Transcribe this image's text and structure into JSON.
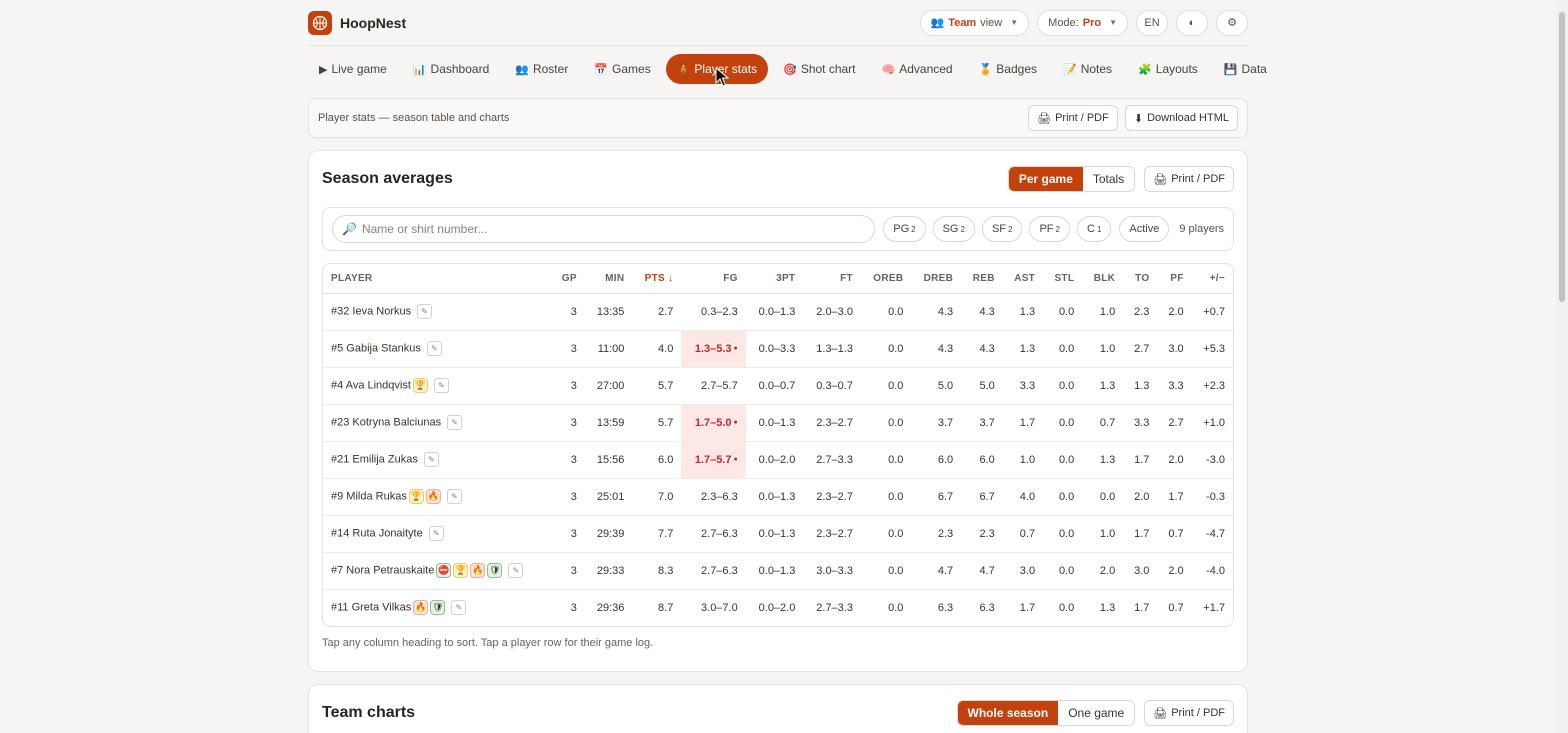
{
  "app": {
    "name": "HoopNest",
    "brand_color": "#c2410c"
  },
  "top": {
    "view_label": "Team",
    "view_suffix": "view",
    "mode_label": "Mode:",
    "mode_value": "Pro",
    "lang": "EN"
  },
  "nav": [
    {
      "icon": "▶",
      "label": "Live game"
    },
    {
      "icon": "📊",
      "label": "Dashboard"
    },
    {
      "icon": "👥",
      "label": "Roster"
    },
    {
      "icon": "📅",
      "label": "Games"
    },
    {
      "icon": "🧍",
      "label": "Player stats",
      "active": true
    },
    {
      "icon": "🎯",
      "label": "Shot chart"
    },
    {
      "icon": "🧠",
      "label": "Advanced"
    },
    {
      "icon": "🏅",
      "label": "Badges"
    },
    {
      "icon": "📝",
      "label": "Notes"
    },
    {
      "icon": "🧩",
      "label": "Layouts"
    },
    {
      "icon": "💾",
      "label": "Data"
    }
  ],
  "subbar": {
    "crumb": "Player stats — season table and charts",
    "print": "Print / PDF",
    "download": "Download HTML"
  },
  "season": {
    "title": "Season averages",
    "seg_per_game": "Per game",
    "seg_totals": "Totals",
    "print": "Print / PDF",
    "search_placeholder": "Name or shirt number...",
    "chips": [
      {
        "label": "PG",
        "count": "2"
      },
      {
        "label": "SG",
        "count": "2"
      },
      {
        "label": "SF",
        "count": "2"
      },
      {
        "label": "PF",
        "count": "2"
      },
      {
        "label": "C",
        "count": "1"
      }
    ],
    "active_chip": "Active",
    "player_count": "9 players",
    "columns": [
      "PLAYER",
      "GP",
      "MIN",
      "PTS ↓",
      "FG",
      "3PT",
      "FT",
      "OREB",
      "DREB",
      "REB",
      "AST",
      "STL",
      "BLK",
      "TO",
      "PF",
      "+/−"
    ],
    "rows": [
      {
        "player": "#32 Ieva Norkus",
        "badges": [],
        "gp": "3",
        "min": "13:35",
        "pts": "2.7",
        "fg": "0.3–2.3",
        "fg_hot": false,
        "tpt": "0.0–1.3",
        "ft": "2.0–3.0",
        "oreb": "0.0",
        "dreb": "4.3",
        "reb": "4.3",
        "ast": "1.3",
        "stl": "0.0",
        "blk": "1.0",
        "to": "2.3",
        "pf": "2.0",
        "pm": "+0.7"
      },
      {
        "player": "#5 Gabija Stankus",
        "badges": [],
        "gp": "3",
        "min": "11:00",
        "pts": "4.0",
        "fg": "1.3–5.3",
        "fg_hot": true,
        "tpt": "0.0–3.3",
        "ft": "1.3–1.3",
        "oreb": "0.0",
        "dreb": "4.3",
        "reb": "4.3",
        "ast": "1.3",
        "stl": "0.0",
        "blk": "1.0",
        "to": "2.7",
        "pf": "3.0",
        "pm": "+5.3"
      },
      {
        "player": "#4 Ava Lindqvist",
        "badges": [
          "trophy"
        ],
        "gp": "3",
        "min": "27:00",
        "pts": "5.7",
        "fg": "2.7–5.7",
        "fg_hot": false,
        "tpt": "0.0–0.7",
        "ft": "0.3–0.7",
        "oreb": "0.0",
        "dreb": "5.0",
        "reb": "5.0",
        "ast": "3.3",
        "stl": "0.0",
        "blk": "1.3",
        "to": "1.3",
        "pf": "3.3",
        "pm": "+2.3"
      },
      {
        "player": "#23 Kotryna Balciunas",
        "badges": [],
        "gp": "3",
        "min": "13:59",
        "pts": "5.7",
        "fg": "1.7–5.0",
        "fg_hot": true,
        "tpt": "0.0–1.3",
        "ft": "2.3–2.7",
        "oreb": "0.0",
        "dreb": "3.7",
        "reb": "3.7",
        "ast": "1.7",
        "stl": "0.0",
        "blk": "0.7",
        "to": "3.3",
        "pf": "2.7",
        "pm": "+1.0"
      },
      {
        "player": "#21 Emilija Zukas",
        "badges": [],
        "gp": "3",
        "min": "15:56",
        "pts": "6.0",
        "fg": "1.7–5.7",
        "fg_hot": true,
        "tpt": "0.0–2.0",
        "ft": "2.7–3.3",
        "oreb": "0.0",
        "dreb": "6.0",
        "reb": "6.0",
        "ast": "1.0",
        "stl": "0.0",
        "blk": "1.3",
        "to": "1.7",
        "pf": "2.0",
        "pm": "-3.0"
      },
      {
        "player": "#9 Milda Rukas",
        "badges": [
          "trophy",
          "fire"
        ],
        "gp": "3",
        "min": "25:01",
        "pts": "7.0",
        "fg": "2.3–6.3",
        "fg_hot": false,
        "tpt": "0.0–1.3",
        "ft": "2.3–2.7",
        "oreb": "0.0",
        "dreb": "6.7",
        "reb": "6.7",
        "ast": "4.0",
        "stl": "0.0",
        "blk": "0.0",
        "to": "2.0",
        "pf": "1.7",
        "pm": "-0.3"
      },
      {
        "player": "#14 Ruta Jonaityte",
        "badges": [],
        "gp": "3",
        "min": "29:39",
        "pts": "7.7",
        "fg": "2.7–6.3",
        "fg_hot": false,
        "tpt": "0.0–1.3",
        "ft": "2.3–2.7",
        "oreb": "0.0",
        "dreb": "2.3",
        "reb": "2.3",
        "ast": "0.7",
        "stl": "0.0",
        "blk": "1.0",
        "to": "1.7",
        "pf": "0.7",
        "pm": "-4.7"
      },
      {
        "player": "#7 Nora Petrauskaite",
        "badges": [
          "block",
          "trophy",
          "fire",
          "shield"
        ],
        "gp": "3",
        "min": "29:33",
        "pts": "8.3",
        "fg": "2.7–6.3",
        "fg_hot": false,
        "tpt": "0.0–1.3",
        "ft": "3.0–3.3",
        "oreb": "0.0",
        "dreb": "4.7",
        "reb": "4.7",
        "ast": "3.0",
        "stl": "0.0",
        "blk": "2.0",
        "to": "3.0",
        "pf": "2.0",
        "pm": "-4.0"
      },
      {
        "player": "#11 Greta Vilkas",
        "badges": [
          "fire",
          "shield"
        ],
        "gp": "3",
        "min": "29:36",
        "pts": "8.7",
        "fg": "3.0–7.0",
        "fg_hot": false,
        "tpt": "0.0–2.0",
        "ft": "2.7–3.3",
        "oreb": "0.0",
        "dreb": "6.3",
        "reb": "6.3",
        "ast": "1.7",
        "stl": "0.0",
        "blk": "1.3",
        "to": "1.7",
        "pf": "0.7",
        "pm": "+1.7"
      }
    ],
    "hint": "Tap any column heading to sort. Tap a player row for their game log."
  },
  "team_charts": {
    "title": "Team charts",
    "seg_whole": "Whole season",
    "seg_one": "One game",
    "print": "Print / PDF"
  }
}
